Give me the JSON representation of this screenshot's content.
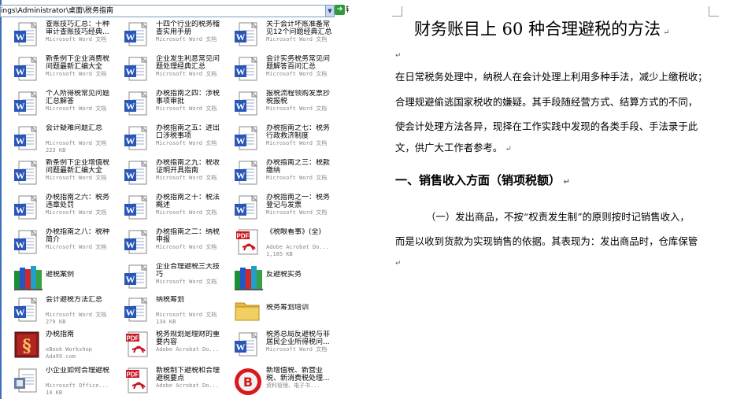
{
  "address_bar": {
    "path": "ings\\Administrator\\桌面\\税务指南",
    "go_label": "转"
  },
  "files": [
    {
      "name": "查账技巧汇总：十种审计查账技巧经典...",
      "type": "Microsoft Word 文档",
      "size": "",
      "icon": "word-doc-icon"
    },
    {
      "name": "十四个行业的税务稽查实用手册",
      "type": "Microsoft Word 文档",
      "size": "",
      "icon": "word-doc-icon"
    },
    {
      "name": "关于会计坏账准备常见12个问题经典汇总",
      "type": "Microsoft Word 文档",
      "size": "",
      "icon": "word-doc-icon"
    },
    {
      "name": "新条例下企业消费税问题最新汇编大全2...",
      "type": "Microsoft Word 文档",
      "size": "",
      "icon": "word-doc-icon"
    },
    {
      "name": "企业发生利息常见问题处理经典汇总",
      "type": "Microsoft Word 文档",
      "size": "",
      "icon": "word-doc-icon"
    },
    {
      "name": "会计实务税务常见问题解答百问汇总",
      "type": "Microsoft Word 文档",
      "size": "",
      "icon": "word-doc-icon"
    },
    {
      "name": "个人所得税常见问题汇总解答",
      "type": "Microsoft Word 文档",
      "size": "",
      "icon": "word-doc-icon"
    },
    {
      "name": "办税指南之四：涉税事项审批",
      "type": "Microsoft Word 文档",
      "size": "",
      "icon": "word-doc-icon"
    },
    {
      "name": "报税流程领购发票抄税报税",
      "type": "Microsoft Word 文档",
      "size": "",
      "icon": "word-doc-icon"
    },
    {
      "name": "会计疑难问题汇总",
      "type": "Microsoft Word 文档",
      "size": "223 KB",
      "icon": "word-doc-icon"
    },
    {
      "name": "办税指南之五：进出口涉税事项",
      "type": "Microsoft Word 文档",
      "size": "",
      "icon": "word-doc-icon"
    },
    {
      "name": "办税指南之七：税务行政救济制度",
      "type": "Microsoft Word 文档",
      "size": "",
      "icon": "word-doc-icon"
    },
    {
      "name": "新条例下企业增值税问题最新汇编大全",
      "type": "Microsoft Word 文档",
      "size": "",
      "icon": "word-doc-icon"
    },
    {
      "name": "办税指南之九：税收证明开具指南",
      "type": "Microsoft Word 文档",
      "size": "",
      "icon": "word-doc-icon"
    },
    {
      "name": "办税指南之三：税款缴纳",
      "type": "Microsoft Word 文档",
      "size": "",
      "icon": "word-doc-icon"
    },
    {
      "name": "办税指南之六：税务违章处罚",
      "type": "Microsoft Word 文档",
      "size": "",
      "icon": "word-doc-icon"
    },
    {
      "name": "办税指南之十：税法概述",
      "type": "Microsoft Word 文档",
      "size": "",
      "icon": "word-doc-icon"
    },
    {
      "name": "办税指南之一：税务登记与发票",
      "type": "Microsoft Word 文档",
      "size": "",
      "icon": "word-doc-icon"
    },
    {
      "name": "办税指南之八：税种简介",
      "type": "Microsoft Word 文档",
      "size": "",
      "icon": "word-doc-icon"
    },
    {
      "name": "办税指南之二：纳税申报",
      "type": "Microsoft Word 文档",
      "size": "",
      "icon": "word-doc-icon"
    },
    {
      "name": "《税眼看事》(全)",
      "type": "Adobe Acrobat Do...",
      "size": "1,185 KB",
      "icon": "pdf-icon"
    },
    {
      "name": "避税案例",
      "type": "",
      "size": "",
      "icon": "books-icon"
    },
    {
      "name": "企业合理避税三大技巧",
      "type": "Microsoft Word 文档",
      "size": "",
      "icon": "word-doc-icon"
    },
    {
      "name": "反避税实务",
      "type": "",
      "size": "",
      "icon": "books-icon"
    },
    {
      "name": "会计避税方法汇总",
      "type": "Microsoft Word 文档",
      "size": "279 KB",
      "icon": "word-doc-icon"
    },
    {
      "name": "纳税筹划",
      "type": "Microsoft Word 文档",
      "size": "134 KB",
      "icon": "word-doc-icon"
    },
    {
      "name": "税务筹划培训",
      "type": "",
      "size": "",
      "icon": "folder-icon"
    },
    {
      "name": "办税指南",
      "type": "eBook Workshop",
      "size": "Ada99.com",
      "icon": "ebook-icon"
    },
    {
      "name": "税务规划是理财的重要内容",
      "type": "Adobe Acrobat Do...",
      "size": "",
      "icon": "pdf-icon"
    },
    {
      "name": "税务总局反避税与非居民企业所得税问...",
      "type": "Microsoft Word 文档",
      "size": "",
      "icon": "word-doc-icon"
    },
    {
      "name": "小企业如何合理避税",
      "type": "Microsoft Office...",
      "size": "14 KB",
      "icon": "office-doc-icon"
    },
    {
      "name": "新税制下避税和合理避税要点",
      "type": "Adobe Acrobat Do...",
      "size": "",
      "icon": "pdf-icon"
    },
    {
      "name": "新增值税、新营业税、新消费税处理...",
      "type": "资料管理、电子书...",
      "size": "",
      "icon": "red-app-icon"
    }
  ],
  "document": {
    "title": "财务账目上 60 种合理避税的方法",
    "intro_lines": [
      "在日常税务处理中，纳税人在会计处理上利用多种手法，减少上缴税收；",
      "合理规避偷逃国家税收的嫌疑。其手段随经营方式、结算方式的不同，",
      "使会计处理方法各异，现择在工作实践中发现的各类手段、手法录于此",
      "文，供广大工作者参考。"
    ],
    "heading": "一、销售收入方面（销项税额）",
    "section_lines": [
      "（一）发出商品，不按“权责发生制”的原则按时记销售收入，",
      "而是以收到货款为实现销售的依据。其表现为：发出商品时，仓库保管"
    ]
  },
  "colors": {
    "word_blue": "#2a56b8",
    "pdf_red": "#c8141e",
    "folder": "#f2cf62",
    "address_border": "#7f9db9"
  }
}
